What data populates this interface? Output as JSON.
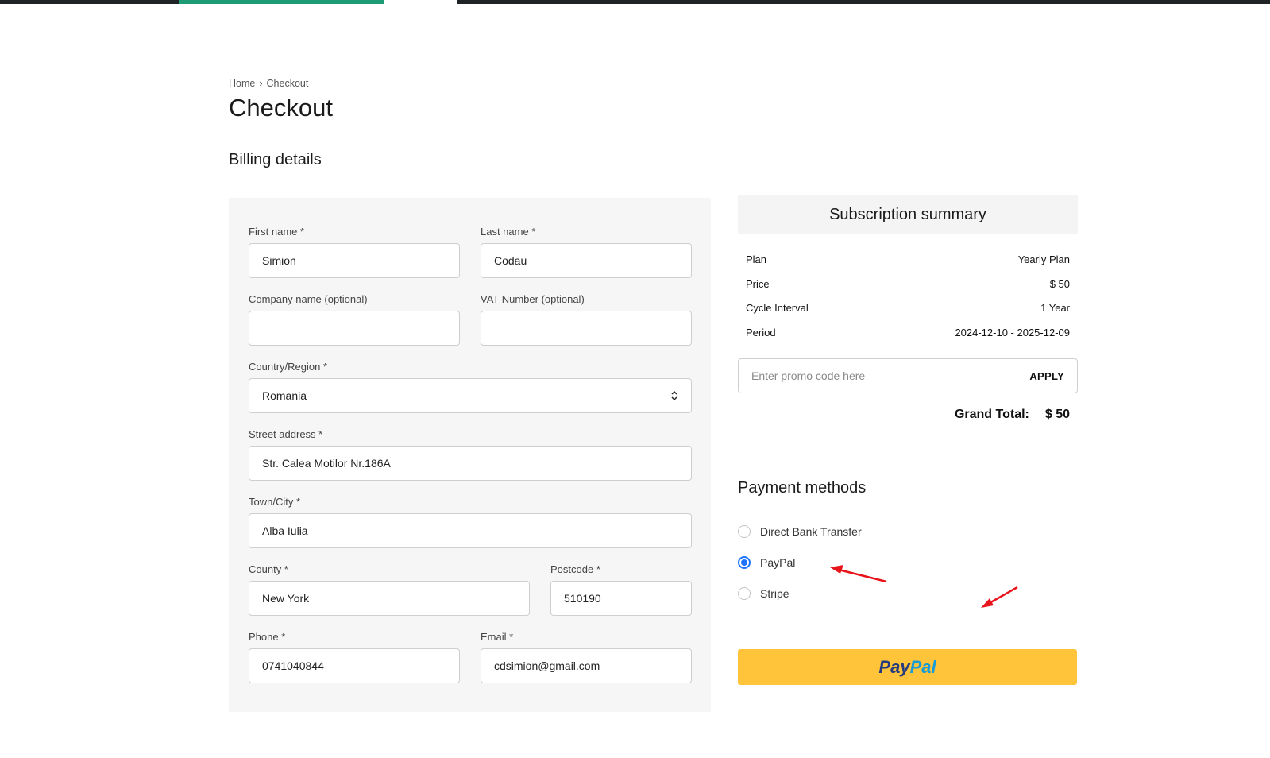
{
  "breadcrumb": {
    "home": "Home",
    "separator": "›",
    "current": "Checkout"
  },
  "page": {
    "title": "Checkout",
    "billing_title": "Billing details"
  },
  "form": {
    "first_name": {
      "label": "First name *",
      "value": "Simion"
    },
    "last_name": {
      "label": "Last name *",
      "value": "Codau"
    },
    "company": {
      "label": "Company name (optional)",
      "value": ""
    },
    "vat": {
      "label": "VAT Number (optional)",
      "value": ""
    },
    "country": {
      "label": "Country/Region *",
      "value": "Romania"
    },
    "street": {
      "label": "Street address *",
      "value": "Str. Calea Motilor Nr.186A"
    },
    "town": {
      "label": "Town/City *",
      "value": "Alba Iulia"
    },
    "county": {
      "label": "County *",
      "value": "New York"
    },
    "postcode": {
      "label": "Postcode *",
      "value": "510190"
    },
    "phone": {
      "label": "Phone *",
      "value": "0741040844"
    },
    "email": {
      "label": "Email *",
      "value": "cdsimion@gmail.com"
    }
  },
  "summary": {
    "title": "Subscription summary",
    "rows": [
      {
        "label": "Plan",
        "value": "Yearly Plan"
      },
      {
        "label": "Price",
        "value": "$ 50"
      },
      {
        "label": "Cycle Interval",
        "value": "1 Year"
      },
      {
        "label": "Period",
        "value": "2024-12-10 - 2025-12-09"
      }
    ],
    "promo_placeholder": "Enter promo code here",
    "apply_label": "APPLY",
    "grand_total_label": "Grand Total:",
    "grand_total_value": "$ 50"
  },
  "payment": {
    "title": "Payment methods",
    "options": [
      {
        "label": "Direct Bank Transfer",
        "selected": false
      },
      {
        "label": "PayPal",
        "selected": true
      },
      {
        "label": "Stripe",
        "selected": false
      }
    ],
    "button_text_1": "Pay",
    "button_text_2": "Pal"
  },
  "colors": {
    "accent_green": "#1e9b72",
    "radio_blue": "#1f74ff",
    "paypal_yellow": "#ffc439",
    "annotation_red": "#e8141b"
  }
}
